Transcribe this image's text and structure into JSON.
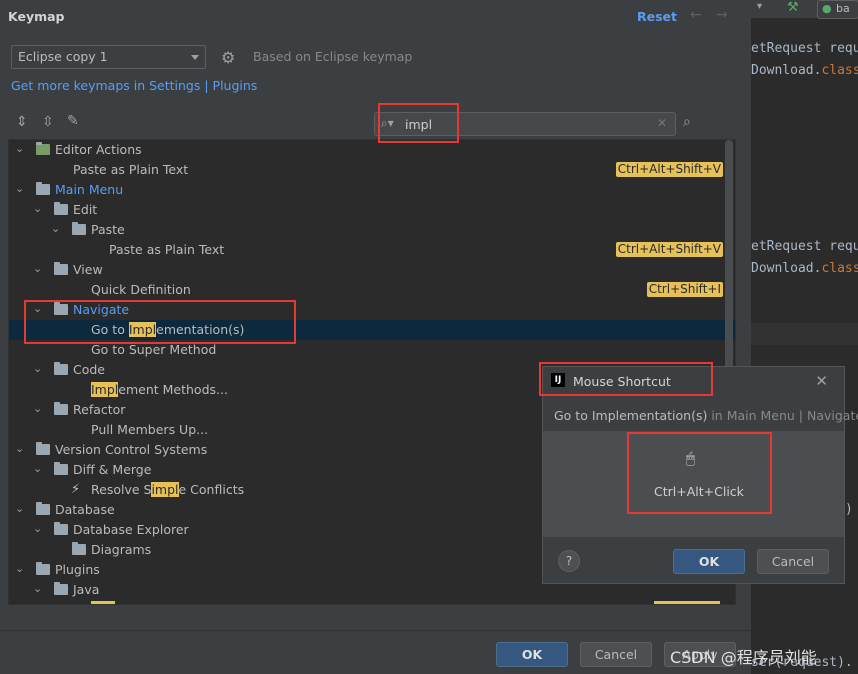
{
  "dialog": {
    "title": "Keymap",
    "reset_label": "Reset",
    "keymap_value": "Eclipse copy 1",
    "based_on": "Based on Eclipse keymap",
    "more_link": "Get more keymaps in Settings | Plugins",
    "search_value": "impl",
    "ok_label": "OK",
    "cancel_label": "Cancel",
    "apply_label": "Apply"
  },
  "tree": {
    "editor_actions": "Editor Actions",
    "paste_plain_1": "Paste as Plain Text",
    "shortcut_paste_1": "Ctrl+Alt+Shift+V",
    "main_menu": "Main Menu",
    "edit": "Edit",
    "paste": "Paste",
    "paste_plain_2": "Paste as Plain Text",
    "shortcut_paste_2": "Ctrl+Alt+Shift+V",
    "view": "View",
    "quick_definition": "Quick Definition",
    "shortcut_quick_def": "Ctrl+Shift+I",
    "navigate": "Navigate",
    "goto_impl_pre": "Go to ",
    "goto_impl_mark": "Impl",
    "goto_impl_post": "ementation(s)",
    "goto_super": "Go to Super Method",
    "code": "Code",
    "impl_methods_mark": "Impl",
    "impl_methods_post": "ement Methods...",
    "refactor": "Refactor",
    "pull_members": "Pull Members Up...",
    "vcs": "Version Control Systems",
    "diff_merge": "Diff & Merge",
    "resolve_pre": "Resolve S",
    "resolve_mark": "impl",
    "resolve_post": "e Conflicts",
    "database": "Database",
    "db_explorer": "Database Explorer",
    "diagrams": "Diagrams",
    "plugins": "Plugins",
    "java": "Java"
  },
  "popup": {
    "title": "Mouse Shortcut",
    "action": "Go to Implementation(s)",
    "path": " in Main Menu | Navigate",
    "shortcut": "Ctrl+Alt+Click",
    "help": "?",
    "ok_label": "OK",
    "cancel_label": "Cancel"
  },
  "editor": {
    "tab_label": "ba",
    "line1": "etRequest reque",
    "line2a": "Download.",
    "line2b": "class",
    "line3": "etRequest requ",
    "line4a": "Download.",
    "line4b": "class",
    "line5": "ser(request).",
    "paren": ")"
  },
  "watermark": "CSDN @程序员刘能"
}
